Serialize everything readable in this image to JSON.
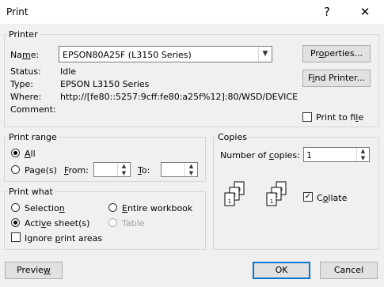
{
  "window": {
    "title": "Print",
    "help_icon": "?",
    "close_icon": "✕"
  },
  "printer": {
    "group_label": "Printer",
    "name_label": "Name:",
    "name_value": "EPSON80A25F (L3150 Series)",
    "status_label": "Status:",
    "status_value": "Idle",
    "type_label": "Type:",
    "type_value": "EPSON L3150 Series",
    "where_label": "Where:",
    "where_value": "http://[fe80::5257:9cff:fe80:a25f%12]:80/WSD/DEVICE",
    "comment_label": "Comment:",
    "comment_value": "",
    "properties_label": "Properties...",
    "find_printer_label": "Find Printer...",
    "print_to_file_label": "Print to file",
    "print_to_file_checked": false
  },
  "print_range": {
    "group_label": "Print range",
    "all_label": "All",
    "pages_label": "Page(s)",
    "from_label": "From:",
    "to_label": "To:",
    "from_value": "",
    "to_value": "",
    "selected": "all"
  },
  "copies": {
    "group_label": "Copies",
    "number_label": "Number of copies:",
    "number_value": "1",
    "collate_label": "Collate",
    "collate_checked": true,
    "collate_icon_pages": [
      "1",
      "2",
      "3",
      "1",
      "2",
      "3"
    ]
  },
  "print_what": {
    "group_label": "Print what",
    "selection_label": "Selection",
    "entire_workbook_label": "Entire workbook",
    "active_sheets_label": "Active sheet(s)",
    "table_label": "Table",
    "ignore_print_areas_label": "Ignore print areas",
    "selected": "active_sheets",
    "ignore_print_areas_checked": false
  },
  "footer": {
    "preview_label": "Preview",
    "ok_label": "OK",
    "cancel_label": "Cancel"
  }
}
